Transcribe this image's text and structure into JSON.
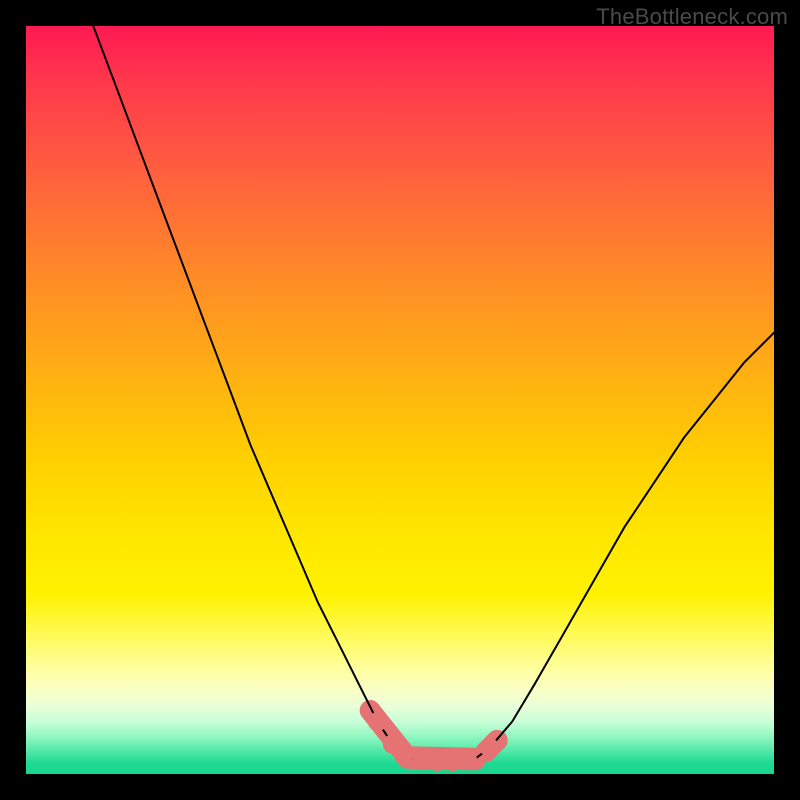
{
  "watermark": "TheBottleneck.com",
  "chart_data": {
    "type": "line",
    "title": "",
    "xlabel": "",
    "ylabel": "",
    "xlim": [
      0,
      100
    ],
    "ylim": [
      0,
      100
    ],
    "grid": false,
    "legend": false,
    "series": [
      {
        "name": "left-branch",
        "x": [
          9,
          12,
          15,
          18,
          21,
          24,
          27,
          30,
          33,
          36,
          39,
          42,
          45,
          47,
          49,
          50.5,
          52
        ],
        "values": [
          100,
          92,
          84,
          76,
          68,
          60,
          52,
          44,
          37,
          30,
          23,
          17,
          11,
          7,
          4,
          2.5,
          2
        ],
        "stroke": "#000000",
        "stroke_width": 2
      },
      {
        "name": "bottom-flat",
        "x": [
          52,
          54,
          56,
          58,
          60
        ],
        "values": [
          2,
          1.7,
          1.7,
          1.8,
          2
        ],
        "stroke": "#000000",
        "stroke_width": 2
      },
      {
        "name": "right-branch",
        "x": [
          60,
          62,
          65,
          68,
          72,
          76,
          80,
          84,
          88,
          92,
          96,
          100
        ],
        "values": [
          2,
          3.5,
          7,
          12,
          19,
          26,
          33,
          39,
          45,
          50,
          55,
          59
        ],
        "stroke": "#000000",
        "stroke_width": 2
      }
    ],
    "markers": [
      {
        "name": "marker-left-1",
        "x": 47,
        "y": 7,
        "r": 1.3,
        "color": "#e57373"
      },
      {
        "name": "marker-left-2",
        "x": 49,
        "y": 4,
        "r": 1.3,
        "color": "#e57373"
      },
      {
        "name": "marker-left-3",
        "x": 50.5,
        "y": 2.5,
        "r": 1.3,
        "color": "#e57373"
      },
      {
        "name": "marker-mid-1",
        "x": 53,
        "y": 1.8,
        "r": 1.3,
        "color": "#e57373"
      },
      {
        "name": "marker-mid-2",
        "x": 55,
        "y": 1.7,
        "r": 1.3,
        "color": "#e57373"
      },
      {
        "name": "marker-mid-3",
        "x": 57,
        "y": 1.7,
        "r": 1.3,
        "color": "#e57373"
      },
      {
        "name": "marker-mid-4",
        "x": 59,
        "y": 1.9,
        "r": 1.3,
        "color": "#e57373"
      },
      {
        "name": "marker-right-1",
        "x": 62,
        "y": 3.5,
        "r": 1.3,
        "color": "#e57373"
      }
    ],
    "marker_segments": [
      {
        "name": "seg-left",
        "x1": 46,
        "y1": 8.5,
        "x2": 51,
        "y2": 2.2,
        "color": "#e57373",
        "width": 2.8
      },
      {
        "name": "seg-flat",
        "x1": 51,
        "y1": 2.2,
        "x2": 60,
        "y2": 2.0,
        "color": "#e57373",
        "width": 3.0
      },
      {
        "name": "seg-right",
        "x1": 61.5,
        "y1": 3.0,
        "x2": 63,
        "y2": 4.5,
        "color": "#e57373",
        "width": 2.8
      }
    ],
    "background_gradient": {
      "top": "#ff1a52",
      "mid": "#ffe600",
      "bottom": "#19d68f"
    }
  }
}
